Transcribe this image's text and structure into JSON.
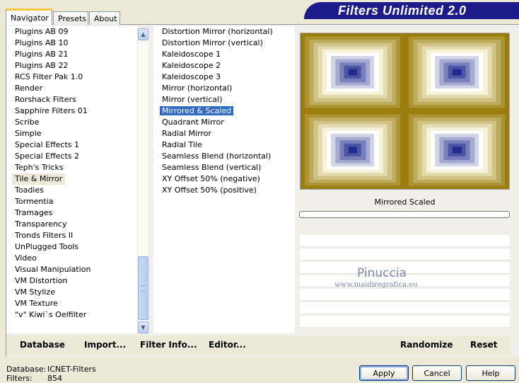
{
  "tabs": [
    {
      "label": "Navigator",
      "active": true
    },
    {
      "label": "Presets",
      "active": false
    },
    {
      "label": "About",
      "active": false
    }
  ],
  "brand": "Filters Unlimited 2.0",
  "categories": {
    "items": [
      "Plugins AB 09",
      "Plugins AB 10",
      "Plugins AB 21",
      "Plugins AB 22",
      "RCS Filter Pak 1.0",
      "Render",
      "Rorshack Filters",
      "Sapphire Filters 01",
      "Scribe",
      "Simple",
      "Special Effects 1",
      "Special Effects 2",
      "Teph's Tricks",
      "Tile & Mirror",
      "Toadies",
      "Tormentia",
      "Tramages",
      "Transparency",
      "Tronds Filters II",
      "UnPlugged Tools",
      "Video",
      "Visual Manipulation",
      "VM Distortion",
      "VM Stylize",
      "VM Texture",
      "\"v\" Kiwi`s Oelfilter"
    ],
    "selected": "Tile & Mirror"
  },
  "filters": {
    "items": [
      "Distortion Mirror (horizontal)",
      "Distortion Mirror (vertical)",
      "Kaleidoscope 1",
      "Kaleidoscope 2",
      "Kaleidoscope 3",
      "Mirror (horizontal)",
      "Mirror (vertical)",
      "Mirrored & Scaled",
      "Quadrant Mirror",
      "Radial Mirror",
      "Radial Tile",
      "Seamless Blend (horizontal)",
      "Seamless Blend (vertical)",
      "XY Offset 50% (negative)",
      "XY Offset 50% (positive)"
    ],
    "selected": "Mirrored & Scaled"
  },
  "preview": {
    "filter_name": "Mirrored  Scaled",
    "colors": {
      "outer": "#9a7d0c",
      "mid": "#f5f2d8",
      "inner": "#ffffff",
      "blue": "#1f2a8c"
    }
  },
  "watermark": {
    "name": "Pinuccia",
    "site": "www.maidiregrafica.eu"
  },
  "bottom_links": {
    "database": "Database",
    "import": "Import...",
    "filter_info": "Filter Info...",
    "editor": "Editor...",
    "randomize": "Randomize",
    "reset": "Reset"
  },
  "status": {
    "database_label": "Database:",
    "database_value": "ICNET-Filters",
    "filters_label": "Filters:",
    "filters_value": "854"
  },
  "buttons": {
    "apply": "Apply",
    "cancel": "Cancel",
    "help": "Help"
  }
}
